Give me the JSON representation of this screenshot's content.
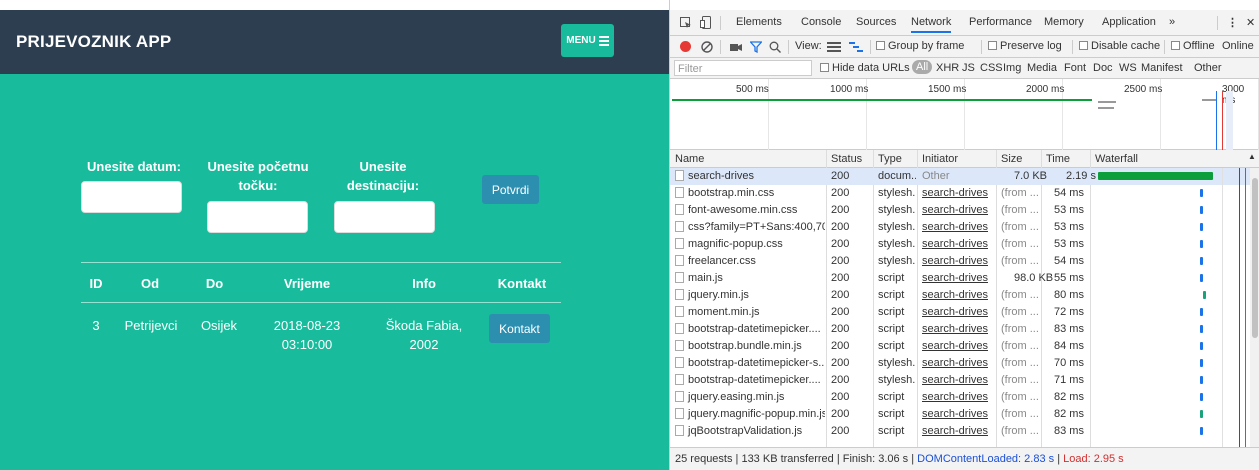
{
  "app": {
    "brand": "PRIJEVOZNIK APP",
    "menu_label": "MENU",
    "form": {
      "date_label": "Unesite datum:",
      "start_label_1": "Unesite početnu",
      "start_label_2": "točku:",
      "dest_label_1": "Unesite",
      "dest_label_2": "destinaciju:",
      "submit_label": "Potvrdi"
    },
    "table": {
      "headers": [
        "ID",
        "Od",
        "Do",
        "Vrijeme",
        "Info",
        "Kontakt"
      ],
      "rows": [
        {
          "id": "3",
          "od": "Petrijevci",
          "do": "Osijek",
          "vrijeme_1": "2018-08-23",
          "vrijeme_2": "03:10:00",
          "info_1": "Škoda Fabia,",
          "info_2": "2002",
          "kontakt": "Kontakt"
        }
      ]
    },
    "colors": {
      "teal": "#18bc9c",
      "navy": "#2c3e50",
      "button_blue": "#2c8fb0"
    }
  },
  "devtools": {
    "tabs": [
      "Elements",
      "Console",
      "Sources",
      "Network",
      "Performance",
      "Memory",
      "Application",
      "»"
    ],
    "active_tab": "Network",
    "toolbar": {
      "view_label": "View:",
      "group_by_frame": "Group by frame",
      "preserve_log": "Preserve log",
      "disable_cache": "Disable cache",
      "offline": "Offline",
      "online": "Online"
    },
    "filter": {
      "placeholder": "Filter",
      "hide_data_urls": "Hide data URLs",
      "types": [
        "All",
        "XHR",
        "JS",
        "CSS",
        "Img",
        "Media",
        "Font",
        "Doc",
        "WS",
        "Manifest",
        "Other"
      ]
    },
    "overview_ticks": [
      "500 ms",
      "1000 ms",
      "1500 ms",
      "2000 ms",
      "2500 ms",
      "3000 ms"
    ],
    "columns": [
      "Name",
      "Status",
      "Type",
      "Initiator",
      "Size",
      "Time",
      "Waterfall"
    ],
    "requests": [
      {
        "name": "search-drives",
        "status": "200",
        "type": "docum...",
        "initiator": "Other",
        "size": "7.0 KB",
        "time": "2.19 s"
      },
      {
        "name": "bootstrap.min.css",
        "status": "200",
        "type": "stylesh...",
        "initiator": "search-drives",
        "size": "(from ...",
        "time": "54 ms"
      },
      {
        "name": "font-awesome.min.css",
        "status": "200",
        "type": "stylesh...",
        "initiator": "search-drives",
        "size": "(from ...",
        "time": "53 ms"
      },
      {
        "name": "css?family=PT+Sans:400,70...",
        "status": "200",
        "type": "stylesh...",
        "initiator": "search-drives",
        "size": "(from ...",
        "time": "53 ms"
      },
      {
        "name": "magnific-popup.css",
        "status": "200",
        "type": "stylesh...",
        "initiator": "search-drives",
        "size": "(from ...",
        "time": "53 ms"
      },
      {
        "name": "freelancer.css",
        "status": "200",
        "type": "stylesh...",
        "initiator": "search-drives",
        "size": "(from ...",
        "time": "54 ms"
      },
      {
        "name": "main.js",
        "status": "200",
        "type": "script",
        "initiator": "search-drives",
        "size": "98.0 KB",
        "time": "55 ms"
      },
      {
        "name": "jquery.min.js",
        "status": "200",
        "type": "script",
        "initiator": "search-drives",
        "size": "(from ...",
        "time": "80 ms"
      },
      {
        "name": "moment.min.js",
        "status": "200",
        "type": "script",
        "initiator": "search-drives",
        "size": "(from ...",
        "time": "72 ms"
      },
      {
        "name": "bootstrap-datetimepicker....",
        "status": "200",
        "type": "script",
        "initiator": "search-drives",
        "size": "(from ...",
        "time": "83 ms"
      },
      {
        "name": "bootstrap.bundle.min.js",
        "status": "200",
        "type": "script",
        "initiator": "search-drives",
        "size": "(from ...",
        "time": "84 ms"
      },
      {
        "name": "bootstrap-datetimepicker-s...",
        "status": "200",
        "type": "stylesh...",
        "initiator": "search-drives",
        "size": "(from ...",
        "time": "70 ms"
      },
      {
        "name": "bootstrap-datetimepicker....",
        "status": "200",
        "type": "stylesh...",
        "initiator": "search-drives",
        "size": "(from ...",
        "time": "71 ms"
      },
      {
        "name": "jquery.easing.min.js",
        "status": "200",
        "type": "script",
        "initiator": "search-drives",
        "size": "(from ...",
        "time": "82 ms"
      },
      {
        "name": "jquery.magnific-popup.min.js",
        "status": "200",
        "type": "script",
        "initiator": "search-drives",
        "size": "(from ...",
        "time": "82 ms"
      },
      {
        "name": "jqBootstrapValidation.js",
        "status": "200",
        "type": "script",
        "initiator": "search-drives",
        "size": "(from ...",
        "time": "83 ms"
      }
    ],
    "status_bar": {
      "summary": "25 requests  |  133 KB transferred  |  Finish: 3.06 s  |",
      "dom_loaded": "DOMContentLoaded: 2.83 s",
      "sep": "|",
      "load": "Load: 2.95 s"
    },
    "colors": {
      "green": "#0b9e3a",
      "blue": "#1a73e8",
      "red": "#e53935",
      "dom_blue": "#1a4fd6",
      "load_red": "#d32f2f"
    }
  }
}
